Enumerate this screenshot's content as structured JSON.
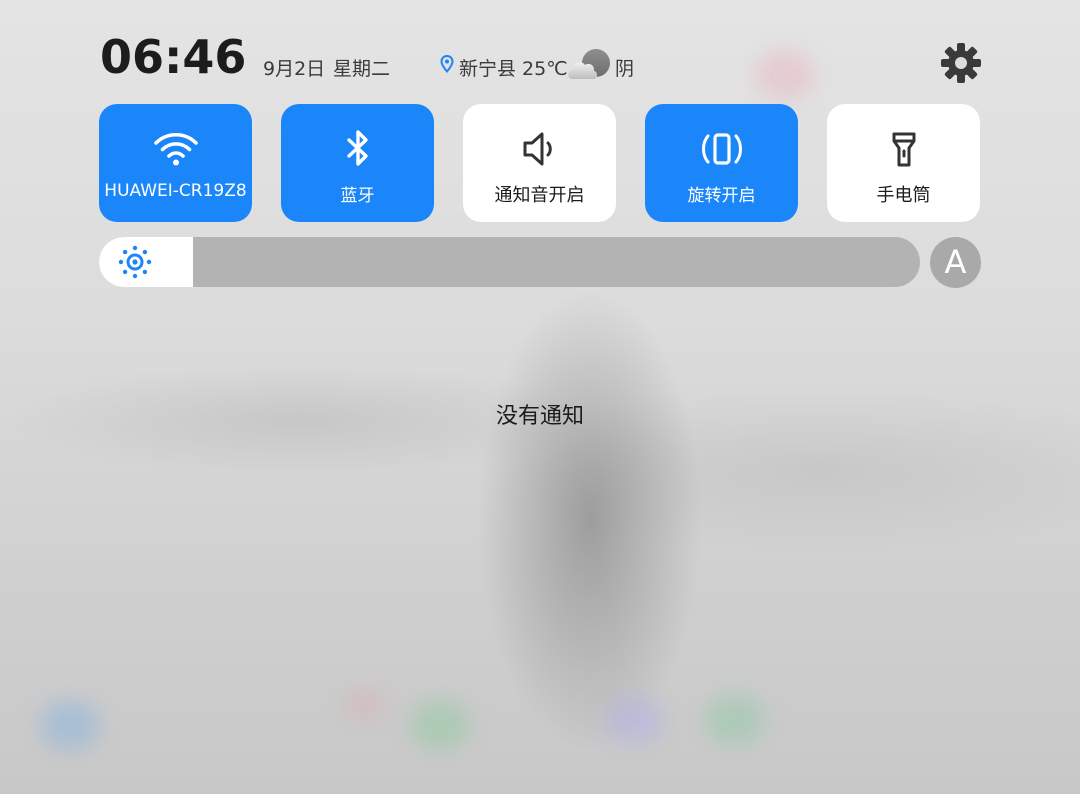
{
  "status": {
    "time": "06:46",
    "date": "9月2日",
    "weekday": "星期二",
    "location_temp": "新宁县 25℃",
    "weather": "阴",
    "icons": {
      "location": "location-pin-icon",
      "weather": "cloud-icon",
      "settings": "gear-icon"
    }
  },
  "toggles": [
    {
      "label": "HUAWEI-CR19Z8",
      "icon": "wifi-icon",
      "active": true
    },
    {
      "label": "蓝牙",
      "icon": "bluetooth-icon",
      "active": true
    },
    {
      "label": "通知音开启",
      "icon": "sound-icon",
      "active": false
    },
    {
      "label": "旋转开启",
      "icon": "auto-rotate-icon",
      "active": true
    },
    {
      "label": "手电筒",
      "icon": "flashlight-icon",
      "active": false
    }
  ],
  "brightness": {
    "level_fraction": 0.115,
    "icon": "brightness-icon",
    "auto_label": "A"
  },
  "notifications": {
    "empty_text": "没有通知"
  },
  "colors": {
    "accent": "#1a86f9",
    "tile_off": "#ffffff",
    "slider_track": "#b3b3b3"
  }
}
